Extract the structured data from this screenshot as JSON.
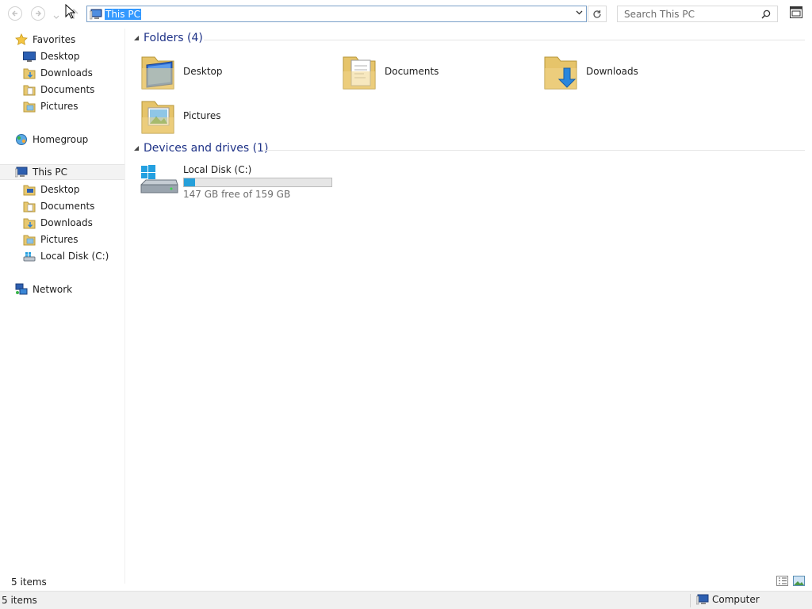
{
  "toolbar": {
    "back_icon": "back-arrow-icon",
    "forward_icon": "forward-arrow-icon",
    "up_icon": "up-arrow-icon",
    "address_value": "This PC",
    "search_placeholder": "Search This PC"
  },
  "nav": {
    "favorites": {
      "label": "Favorites",
      "items": [
        {
          "label": "Desktop",
          "icon": "desktop-icon"
        },
        {
          "label": "Downloads",
          "icon": "downloads-folder-icon"
        },
        {
          "label": "Documents",
          "icon": "documents-folder-icon"
        },
        {
          "label": "Pictures",
          "icon": "pictures-folder-icon"
        }
      ]
    },
    "homegroup": {
      "label": "Homegroup"
    },
    "this_pc": {
      "label": "This PC",
      "items": [
        {
          "label": "Desktop"
        },
        {
          "label": "Documents"
        },
        {
          "label": "Downloads"
        },
        {
          "label": "Pictures"
        },
        {
          "label": "Local Disk (C:)"
        }
      ]
    },
    "network": {
      "label": "Network"
    }
  },
  "content": {
    "folders_header": "Folders (4)",
    "folders": [
      {
        "label": "Desktop"
      },
      {
        "label": "Documents"
      },
      {
        "label": "Downloads"
      },
      {
        "label": "Pictures"
      }
    ],
    "drives_header": "Devices and drives (1)",
    "drive": {
      "name": "Local Disk (C:)",
      "free_text": "147 GB free of 159 GB",
      "used_fraction": 0.075
    }
  },
  "status": {
    "item_count": "5 items",
    "statusbar_count": "5 items",
    "location": "Computer"
  },
  "colors": {
    "accent": "#3399ff",
    "group_header": "#1e3287",
    "drive_bar": "#26a0da"
  }
}
